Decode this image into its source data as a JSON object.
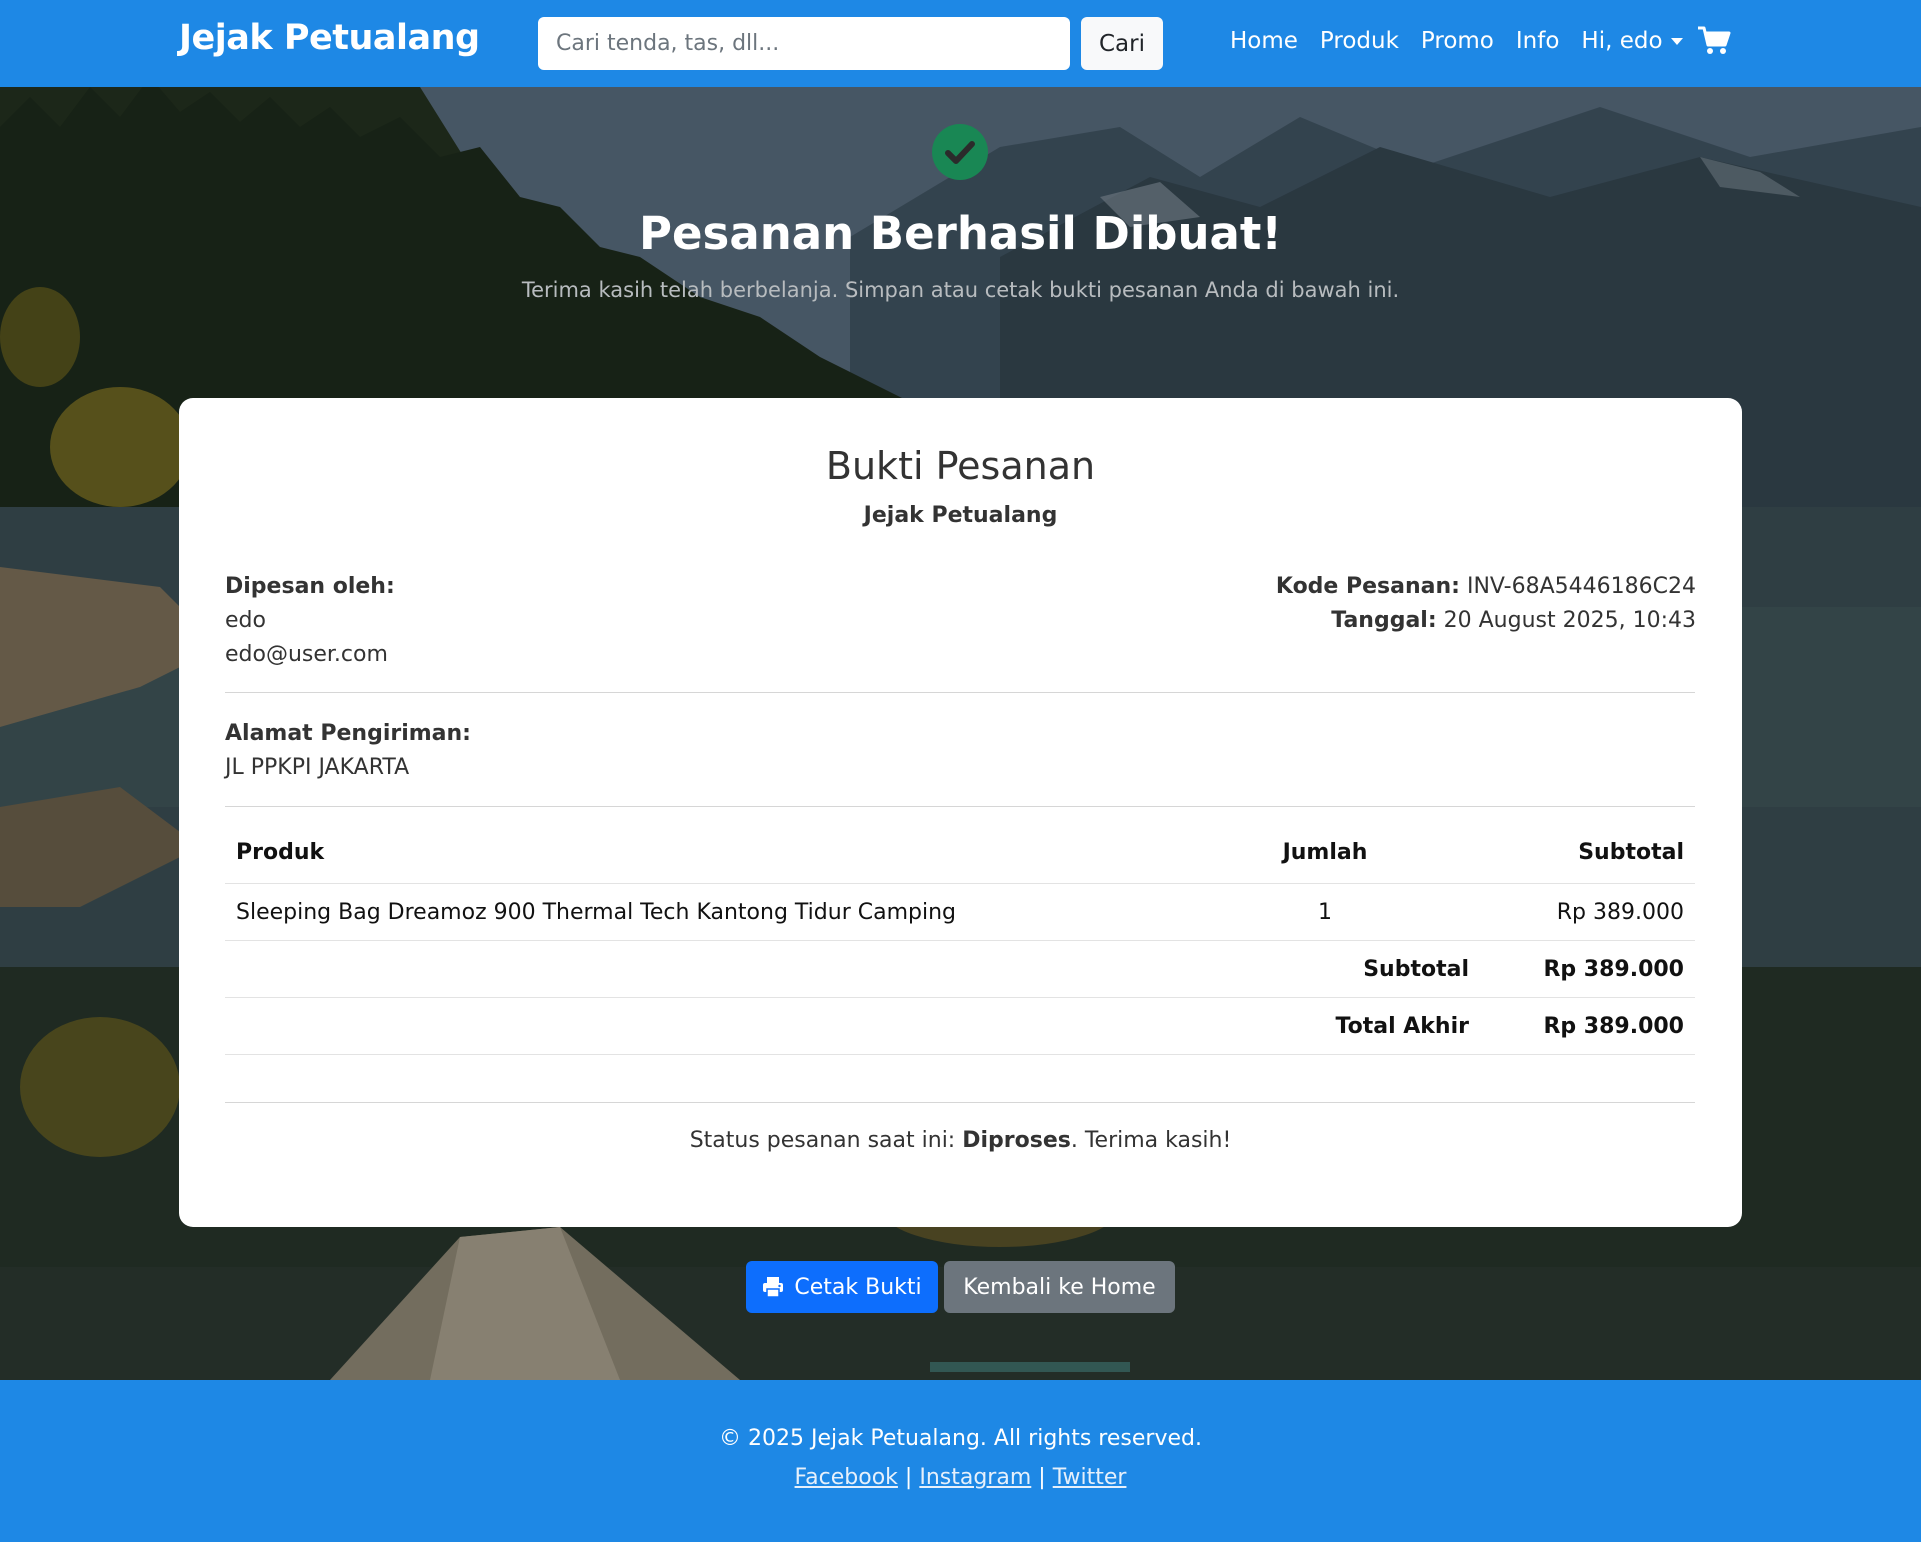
{
  "navbar": {
    "brand": "Jejak Petualang",
    "search_placeholder": "Cari tenda, tas, dll...",
    "search_button": "Cari",
    "links": [
      "Home",
      "Produk",
      "Promo",
      "Info"
    ],
    "user_menu": "Hi, edo",
    "cart_icon": "cart-icon"
  },
  "hero": {
    "icon": "check-circle-icon",
    "title": "Pesanan Berhasil Dibuat!",
    "subtitle": "Terima kasih telah berbelanja. Simpan atau cetak bukti pesanan Anda di bawah ini."
  },
  "receipt": {
    "title": "Bukti Pesanan",
    "store": "Jejak Petualang",
    "ordered_by_label": "Dipesan oleh:",
    "customer_name": "edo",
    "customer_email": "edo@user.com",
    "order_code_label": "Kode Pesanan:",
    "order_code": "INV-68A5446186C24",
    "date_label": "Tanggal:",
    "date": "20 August 2025, 10:43",
    "address_label": "Alamat Pengiriman:",
    "address": "JL PPKPI JAKARTA",
    "table": {
      "headers": {
        "product": "Produk",
        "qty": "Jumlah",
        "subtotal": "Subtotal"
      },
      "rows": [
        {
          "product": "Sleeping Bag Dreamoz 900 Thermal Tech Kantong Tidur Camping",
          "qty": "1",
          "subtotal": "Rp 389.000"
        }
      ],
      "subtotal_label": "Subtotal",
      "subtotal_value": "Rp 389.000",
      "total_label": "Total Akhir",
      "total_value": "Rp 389.000"
    },
    "status_prefix": "Status pesanan saat ini: ",
    "status_value": "Diproses",
    "status_suffix": ". Terima kasih!"
  },
  "actions": {
    "print_label": "Cetak Bukti",
    "print_icon": "printer-icon",
    "home_label": "Kembali ke Home"
  },
  "footer": {
    "copyright": "© 2025 Jejak Petualang. All rights reserved.",
    "social": [
      "Facebook",
      "Instagram",
      "Twitter"
    ],
    "separator": "|"
  },
  "colors": {
    "primary": "#1e88e5",
    "button_primary": "#0d6efd",
    "button_secondary": "#6c757d",
    "success": "#198754"
  }
}
